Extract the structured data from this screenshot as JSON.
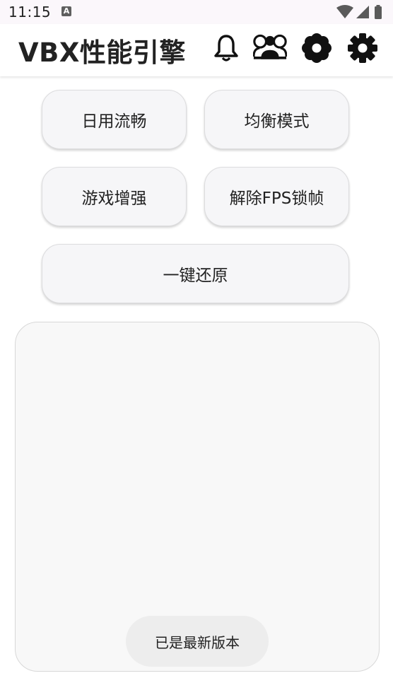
{
  "status_bar": {
    "time": "11:15",
    "notification_badge": "A",
    "icons": [
      "wifi-icon",
      "signal-icon",
      "battery-icon"
    ]
  },
  "app_bar": {
    "title": "VBX性能引擎",
    "actions": [
      "bell-icon",
      "group-icon",
      "settings-flower-icon",
      "gear-icon"
    ]
  },
  "modes": {
    "daily_smooth": "日用流畅",
    "balanced": "均衡模式",
    "game_boost": "游戏增强",
    "unlock_fps": "解除FPS锁帧",
    "restore": "一键还原"
  },
  "log_panel": {
    "content": ""
  },
  "toast": {
    "message": "已是最新版本"
  },
  "colors": {
    "button_bg": "#f6f6f8",
    "panel_bg": "#f8f8f8",
    "toast_bg": "#ededed",
    "text": "#222222"
  }
}
